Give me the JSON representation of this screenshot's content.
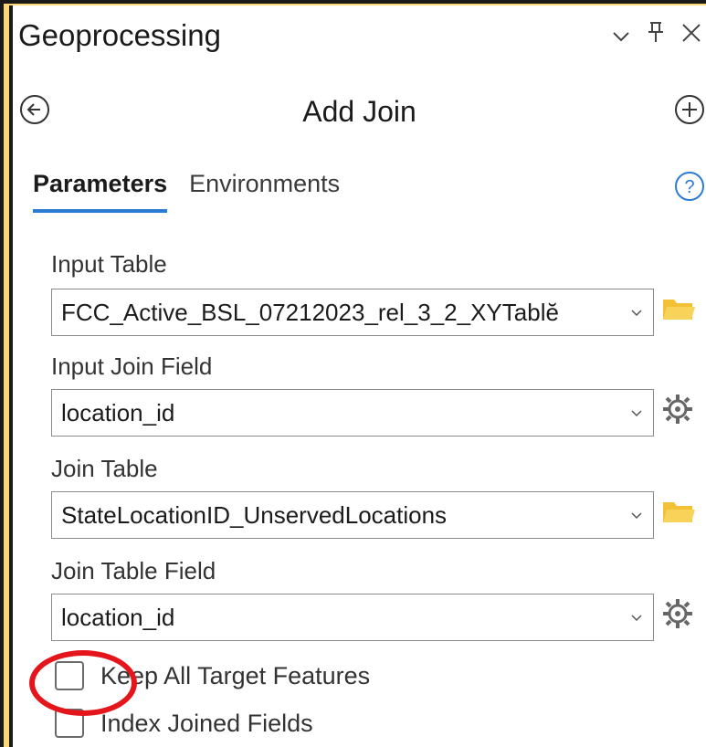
{
  "window": {
    "title": "Geoprocessing",
    "controls": {
      "collapse_icon": "chevron-down-icon",
      "pin_icon": "pin-icon",
      "close_icon": "close-icon"
    }
  },
  "tool": {
    "title": "Add Join",
    "back_icon": "back-circle-icon",
    "add_icon": "add-circle-icon"
  },
  "tabs": [
    {
      "label": "Parameters",
      "active": true
    },
    {
      "label": "Environments",
      "active": false
    }
  ],
  "help_icon": "help-circle-icon",
  "params": {
    "input_table": {
      "label": "Input Table",
      "value": "FCC_Active_BSL_07212023_rel_3_2_XYTablĕ",
      "side_icon": "folder-icon"
    },
    "input_join_field": {
      "label": "Input Join Field",
      "value": "location_id",
      "side_icon": "gear-icon"
    },
    "join_table": {
      "label": "Join Table",
      "value": "StateLocationID_UnservedLocations",
      "side_icon": "folder-icon"
    },
    "join_table_field": {
      "label": "Join Table Field",
      "value": "location_id",
      "side_icon": "gear-icon"
    }
  },
  "checkboxes": [
    {
      "label": "Keep All Target Features",
      "checked": false
    },
    {
      "label": "Index Joined Fields",
      "checked": false
    }
  ],
  "colors": {
    "background": "#f9d877",
    "accent": "#2b7bd4",
    "annotation": "#e4151b",
    "folder": "#f2c136"
  }
}
